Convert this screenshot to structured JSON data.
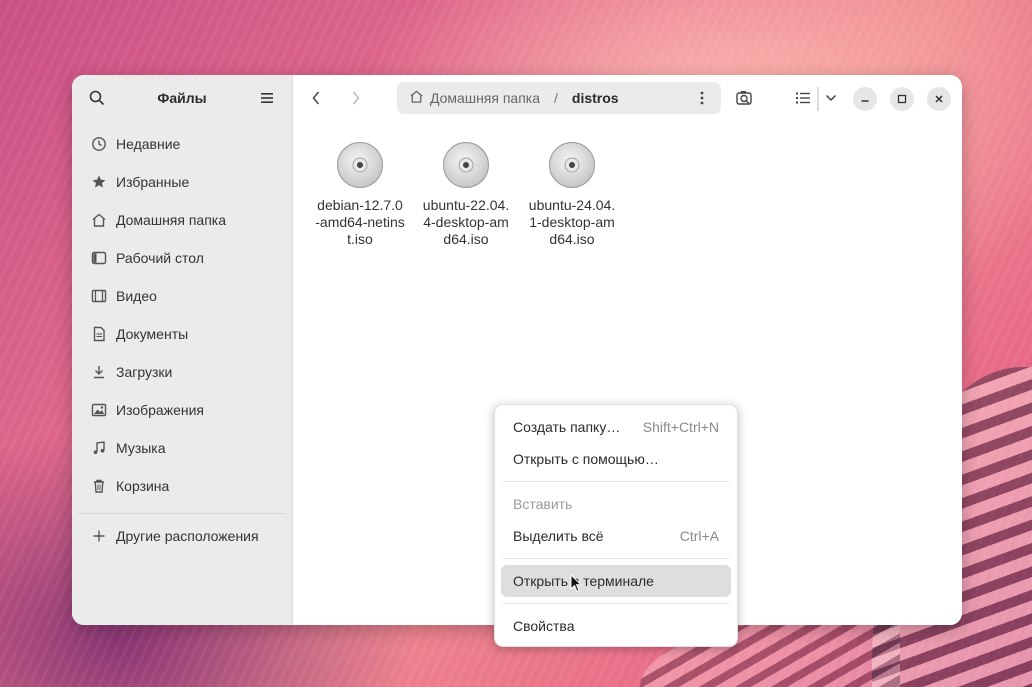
{
  "sidebar": {
    "title": "Файлы",
    "items": [
      {
        "label": "Недавние",
        "icon": "clock-icon"
      },
      {
        "label": "Избранные",
        "icon": "star-icon"
      },
      {
        "label": "Домашняя папка",
        "icon": "home-icon"
      },
      {
        "label": "Рабочий стол",
        "icon": "desktop-icon"
      },
      {
        "label": "Видео",
        "icon": "film-icon"
      },
      {
        "label": "Документы",
        "icon": "document-icon"
      },
      {
        "label": "Загрузки",
        "icon": "download-icon"
      },
      {
        "label": "Изображения",
        "icon": "image-icon"
      },
      {
        "label": "Музыка",
        "icon": "music-icon"
      },
      {
        "label": "Корзина",
        "icon": "trash-icon"
      }
    ],
    "other_locations": "Другие расположения"
  },
  "pathbar": {
    "home": "Домашняя папка",
    "separator": "/",
    "current": "distros"
  },
  "files": [
    {
      "name": "debian-12.7.0-amd64-netinst.iso"
    },
    {
      "name": "ubuntu-22.04.4-desktop-amd64.iso"
    },
    {
      "name": "ubuntu-24.04.1-desktop-amd64.iso"
    }
  ],
  "context_menu": {
    "items": [
      {
        "label": "Создать папку…",
        "accel": "Shift+Ctrl+N"
      },
      {
        "label": "Открыть с помощью…",
        "accel": ""
      },
      {
        "label": "Вставить",
        "accel": ""
      },
      {
        "label": "Выделить всё",
        "accel": "Ctrl+A"
      },
      {
        "label": "Открыть в терминале",
        "accel": ""
      },
      {
        "label": "Свойства",
        "accel": ""
      }
    ]
  },
  "colors": {
    "accent": "#e95420",
    "sidebar_bg": "#ebebeb",
    "hover_bg": "#dedede"
  }
}
